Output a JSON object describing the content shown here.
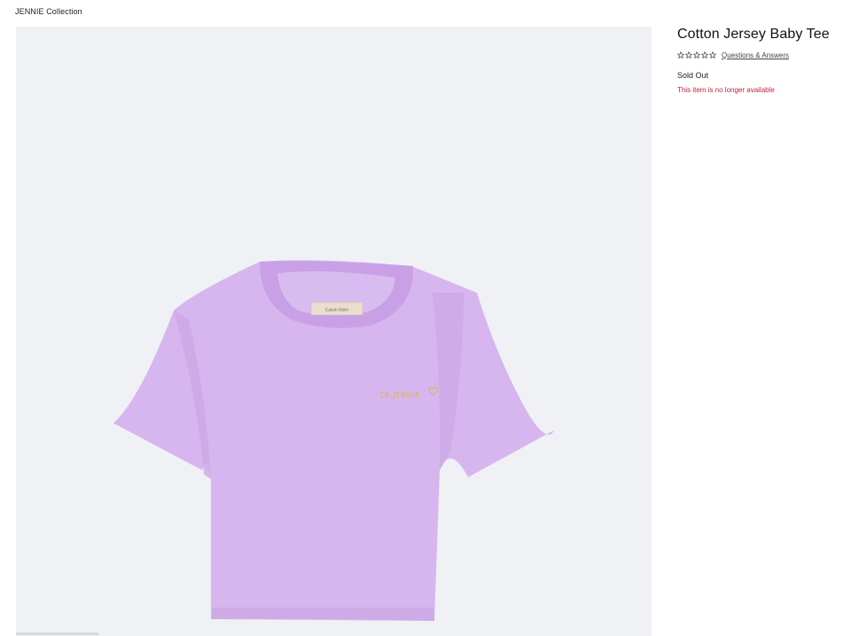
{
  "breadcrumb": {
    "label": "JENNIE Collection"
  },
  "product": {
    "title": "Cotton Jersey Baby Tee",
    "rating_stars": 0,
    "rating_max": 5,
    "qa_link_label": "Questions & Answers",
    "stock_status": "Sold Out",
    "availability_message": "This item is no longer available",
    "image": {
      "subject": "lilac cropped t-shirt with embroidered chest logo",
      "chest_logo_text": "CK JENNIE",
      "neck_label_text": "Calvin Klein"
    }
  },
  "colors": {
    "image_background": "#eff1f5",
    "shirt_body": "#d7b5ee",
    "shirt_collar": "#c9a0e6",
    "alert_text": "#c0253b",
    "logo_embroidery": "#d9b54a"
  }
}
